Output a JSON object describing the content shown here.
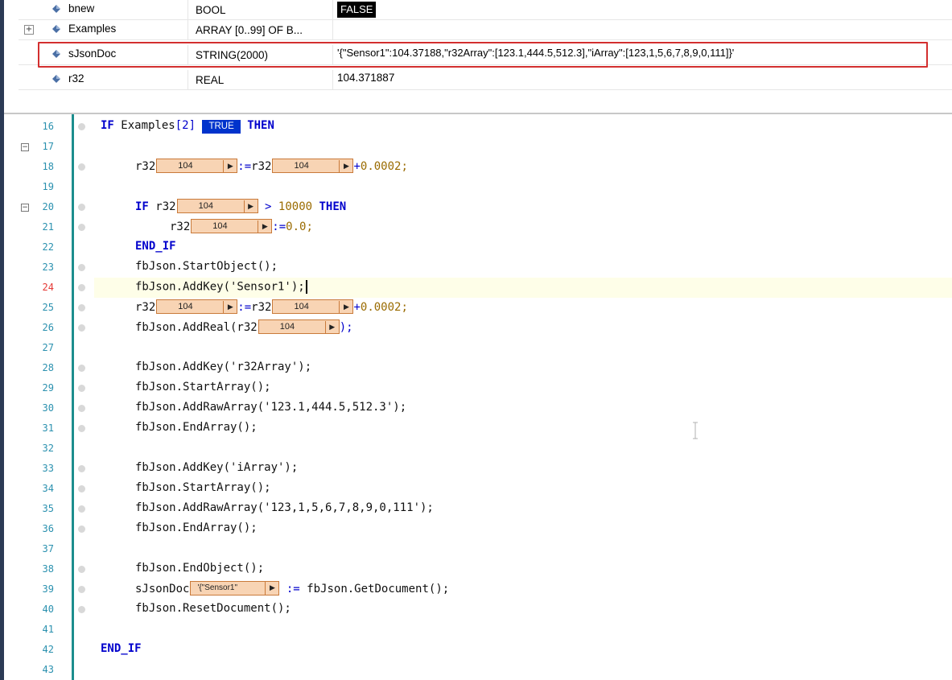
{
  "watch": {
    "rows": [
      {
        "name": "bnew",
        "type": "BOOL",
        "value": "FALSE"
      },
      {
        "name": "Examples",
        "type": "ARRAY [0..99] OF B...",
        "value": "",
        "expand": "+"
      },
      {
        "name": "sJsonDoc",
        "type": "STRING(2000)",
        "value": "'{\"Sensor1\":104.37188,\"r32Array\":[123.1,444.5,512.3],\"iArray\":[123,1,5,6,7,8,9,0,111]}'"
      },
      {
        "name": "r32",
        "type": "REAL",
        "value": "104.371887"
      }
    ]
  },
  "editor": {
    "monitor": {
      "r32": "104",
      "bool_true": "TRUE",
      "json": "'{\"Sensor1\""
    },
    "fold_minus": "−",
    "lines": [
      {
        "n": "16",
        "t": "IF Examples[2]"
      },
      {
        "n": "17"
      },
      {
        "n": "18"
      },
      {
        "n": "19"
      },
      {
        "n": "20"
      },
      {
        "n": "21"
      },
      {
        "n": "22",
        "t": "END_IF"
      },
      {
        "n": "23",
        "t": "fbJson.StartObject();"
      },
      {
        "n": "24",
        "t": "fbJson.AddKey('Sensor1');"
      },
      {
        "n": "25"
      },
      {
        "n": "26"
      },
      {
        "n": "27"
      },
      {
        "n": "28",
        "t": "fbJson.AddKey('r32Array');"
      },
      {
        "n": "29",
        "t": "fbJson.StartArray();"
      },
      {
        "n": "30",
        "t": "fbJson.AddRawArray('123.1,444.5,512.3');"
      },
      {
        "n": "31",
        "t": "fbJson.EndArray();"
      },
      {
        "n": "32"
      },
      {
        "n": "33",
        "t": "fbJson.AddKey('iArray');"
      },
      {
        "n": "34",
        "t": "fbJson.StartArray();"
      },
      {
        "n": "35",
        "t": "fbJson.AddRawArray('123,1,5,6,7,8,9,0,111');"
      },
      {
        "n": "36",
        "t": "fbJson.EndArray();"
      },
      {
        "n": "37"
      },
      {
        "n": "38",
        "t": "fbJson.EndObject();"
      },
      {
        "n": "39"
      },
      {
        "n": "40",
        "t": "fbJson.ResetDocument();"
      },
      {
        "n": "41"
      },
      {
        "n": "42",
        "t": "END_IF"
      },
      {
        "n": "43"
      }
    ],
    "tokens": {
      "then": "THEN",
      "if": "IF",
      "r32": "r32",
      "assign": ":=",
      "plus": "+",
      "inc": "0.0002;",
      "gt": ">",
      "limit": "10000",
      "zero": "0.0;",
      "addreal": "fbJson.AddReal(r32",
      "close": ");",
      "sjson": "sJsonDoc",
      "getdoc": "fbJson.GetDocument();"
    }
  }
}
